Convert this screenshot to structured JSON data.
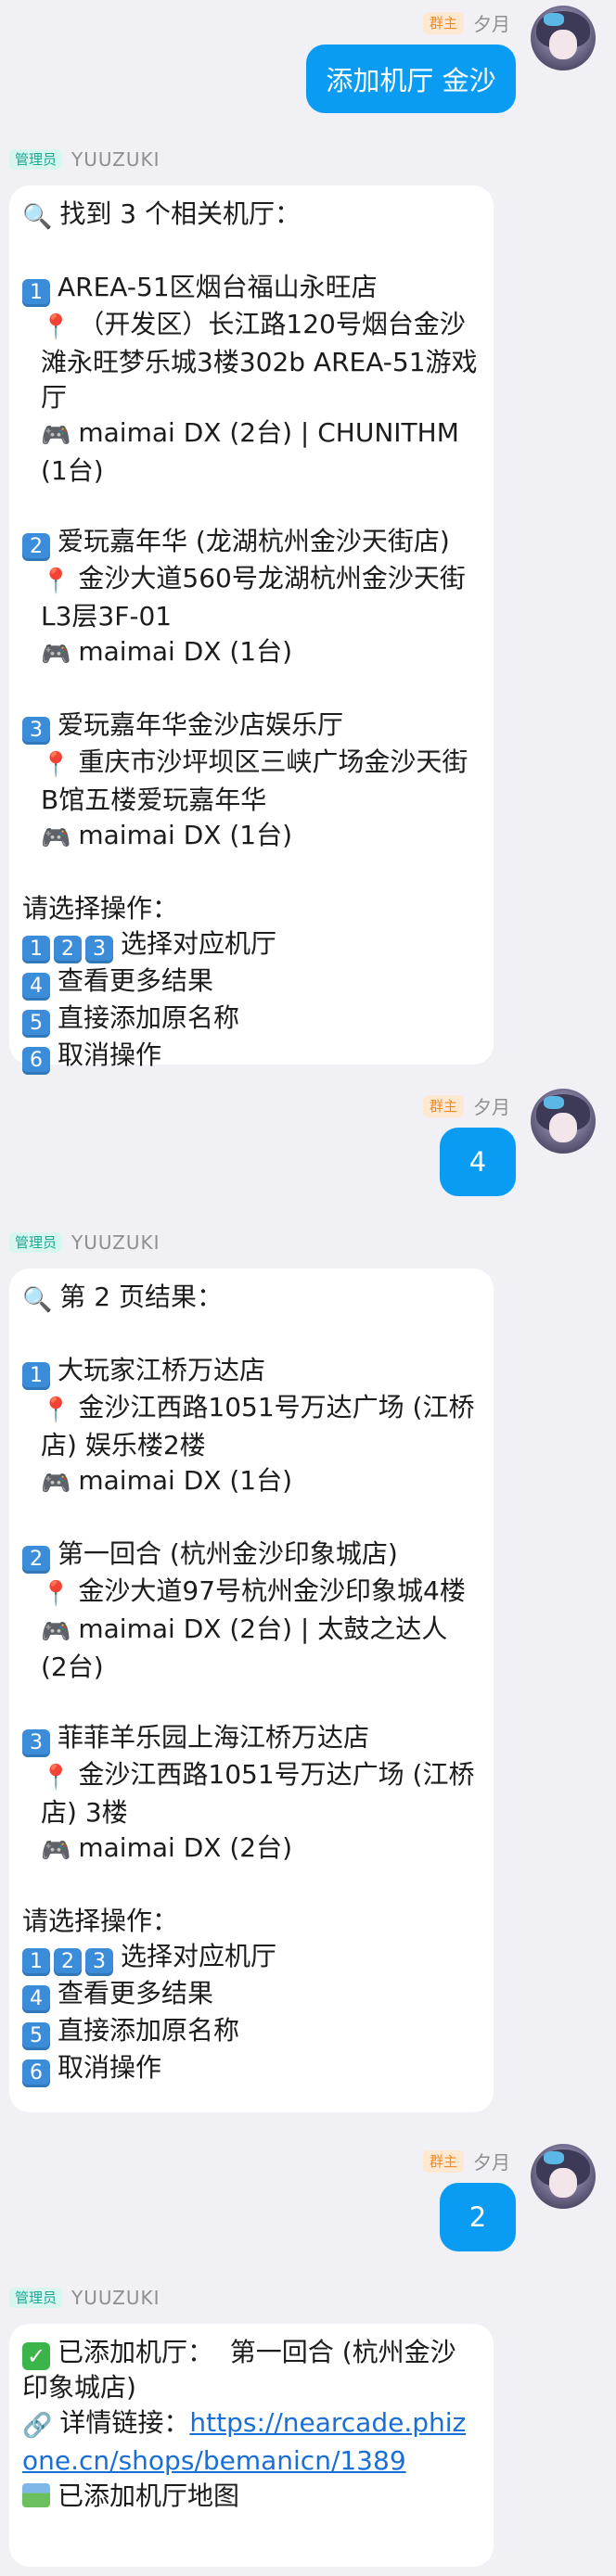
{
  "owner_badge": "群主",
  "admin_badge": "管理员",
  "sender_out": "夕月",
  "sender_in": "YUUZUKI",
  "messages": {
    "m1": {
      "text": "添加机厅 金沙"
    },
    "m2": {
      "header": "找到 3 个相关机厅：",
      "items": [
        {
          "num": "1",
          "name": "AREA-51区烟台福山永旺店",
          "address": "（开发区）长江路120号烟台金沙滩永旺梦乐城3楼302b AREA-51游戏厅",
          "games": "maimai DX (2台) | CHUNITHM (1台)"
        },
        {
          "num": "2",
          "name": "爱玩嘉年华 (龙湖杭州金沙天街店)",
          "address": "金沙大道560号龙湖杭州金沙天街L3层3F-01",
          "games": "maimai DX (1台)"
        },
        {
          "num": "3",
          "name": "爱玩嘉年华金沙店娱乐厅",
          "address": "重庆市沙坪坝区三峡广场金沙天街B馆五楼爱玩嘉年华",
          "games": "maimai DX (1台)"
        }
      ],
      "prompt": "请选择操作：",
      "options": {
        "select": "选择对应机厅",
        "more": "查看更多结果",
        "add_raw": "直接添加原名称",
        "cancel": "取消操作"
      }
    },
    "m3": {
      "text": "4"
    },
    "m4": {
      "header": "第 2 页结果：",
      "items": [
        {
          "num": "1",
          "name": "大玩家江桥万达店",
          "address": "金沙江西路1051号万达广场 (江桥店) 娱乐楼2楼",
          "games": "maimai DX (1台)"
        },
        {
          "num": "2",
          "name": "第一回合 (杭州金沙印象城店)",
          "address": "金沙大道97号杭州金沙印象城4楼",
          "games": "maimai DX (2台) | 太鼓之达人 (2台)"
        },
        {
          "num": "3",
          "name": "菲菲羊乐园上海江桥万达店",
          "address": "金沙江西路1051号万达广场 (江桥店) 3楼",
          "games": "maimai DX (2台)"
        }
      ],
      "prompt": "请选择操作：",
      "options": {
        "select": "选择对应机厅",
        "more": "查看更多结果",
        "add_raw": "直接添加原名称",
        "cancel": "取消操作"
      }
    },
    "m5": {
      "text": "2"
    },
    "m6": {
      "added": "已添加机厅：  第一回合 (杭州金沙印象城店)",
      "link_label": "详情链接：",
      "link_url": "https://nearcade.phizone.cn/shops/bemanicn/1389",
      "map_text": "已添加机厅地图"
    }
  }
}
